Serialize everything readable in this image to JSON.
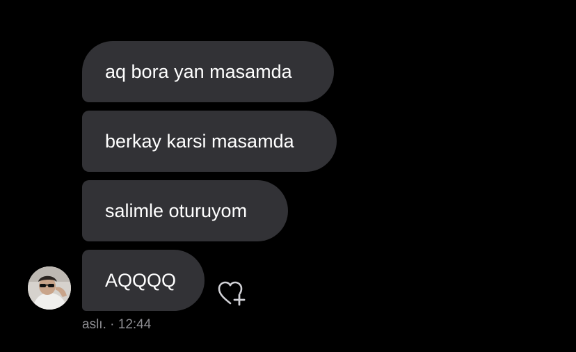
{
  "messages": [
    {
      "text": "aq bora yan masamda"
    },
    {
      "text": "berkay karsi masamda"
    },
    {
      "text": "salimle oturuyom"
    },
    {
      "text": "AQQQQ"
    }
  ],
  "meta": {
    "sender": "aslı.",
    "time": "· 12:44"
  },
  "icons": {
    "reaction": "heart-plus-icon",
    "avatar": "avatar"
  },
  "colors": {
    "background": "#000000",
    "bubble": "#323236",
    "text": "#ffffff",
    "meta_text": "#8e8e93"
  }
}
